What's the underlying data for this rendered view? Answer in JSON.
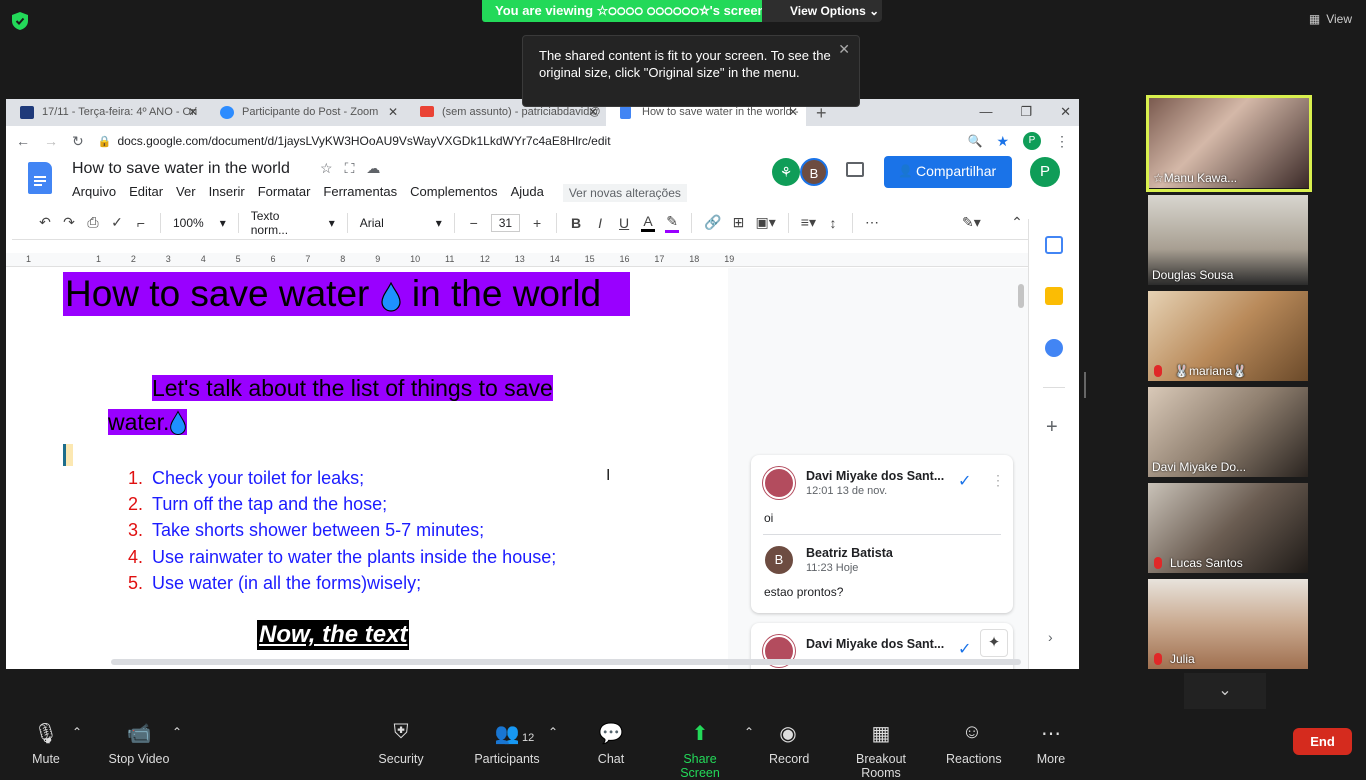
{
  "zoom": {
    "banner_text": "You are viewing ☆੦੦੦੦ ੦੦੦੦੦੦☆'s screen",
    "view_options": "View Options",
    "view_label": "View",
    "tooltip": "The shared content is fit to your screen. To see the original size, click \"Original size\" in the menu.",
    "participants_count": "12",
    "toolbar": [
      {
        "label": "Mute"
      },
      {
        "label": "Stop Video"
      },
      {
        "label": "Security"
      },
      {
        "label": "Participants"
      },
      {
        "label": "Chat"
      },
      {
        "label": "Share Screen"
      },
      {
        "label": "Record"
      },
      {
        "label": "Breakout Rooms"
      },
      {
        "label": "Reactions"
      },
      {
        "label": "More"
      }
    ],
    "end_label": "End",
    "gallery": [
      {
        "name": "☆Manu Kawa..."
      },
      {
        "name": "Douglas Sousa"
      },
      {
        "name": "🐰mariana🐰"
      },
      {
        "name": "Davi Miyake Do..."
      },
      {
        "name": "Lucas Santos"
      },
      {
        "name": "Julia"
      }
    ]
  },
  "browser": {
    "tabs": [
      {
        "title": "17/11 - Terça-feira: 4º ANO - Ori",
        "color": "#1f3a7a"
      },
      {
        "title": "Participante do Post - Zoom",
        "color": "#2d8cff"
      },
      {
        "title": "(sem assunto) - patriciabdavid@",
        "color": "#ea4335"
      },
      {
        "title": "How to save water in the world -",
        "color": "#4285f4"
      }
    ],
    "url": "docs.google.com/document/d/1jaysLVyKW3HOoAU9VsWayVXGDk1LkdWYr7c4aE8Hlrc/edit",
    "profile_letter": "P"
  },
  "docs": {
    "title": "How to save water in the world",
    "menu": [
      "Arquivo",
      "Editar",
      "Ver",
      "Inserir",
      "Formatar",
      "Ferramentas",
      "Complementos",
      "Ajuda"
    ],
    "new_changes": "Ver novas alterações",
    "share_label": "Compartilhar",
    "collab_letter": "B",
    "user_letter": "P",
    "zoom": "100%",
    "style": "Texto norm...",
    "font": "Arial",
    "font_size": "31",
    "ruler": [
      "1",
      "1",
      "2",
      "3",
      "4",
      "5",
      "6",
      "7",
      "8",
      "9",
      "10",
      "11",
      "12",
      "13",
      "14",
      "15",
      "16",
      "17",
      "18",
      "19"
    ],
    "heading_before": "How to save water ",
    "heading_after": " in the world",
    "subheading_line1": "Let's talk about the list of things to save",
    "subheading_line2": "water.",
    "list": [
      {
        "n": "1.",
        "text": "Check your toilet for leaks;"
      },
      {
        "n": "2.",
        "text": "Turn off the tap and the hose;"
      },
      {
        "n": "3.",
        "text": "Take shorts shower between 5-7 minutes;"
      },
      {
        "n": "4.",
        "text": "Use rainwater to water the plants inside the house;"
      },
      {
        "n": "5.",
        "text": "Use water (in all the forms)wisely;"
      }
    ],
    "now_text": "Now, the text",
    "comments": [
      {
        "author": "Davi Miyake dos Sant...",
        "time": "12:01 13 de nov.",
        "text": "oi"
      },
      {
        "author": "Beatriz Batista",
        "time": "11:23 Hoje",
        "text": "estao prontos?",
        "letter": "B"
      },
      {
        "author": "Davi Miyake dos Sant..."
      }
    ]
  }
}
